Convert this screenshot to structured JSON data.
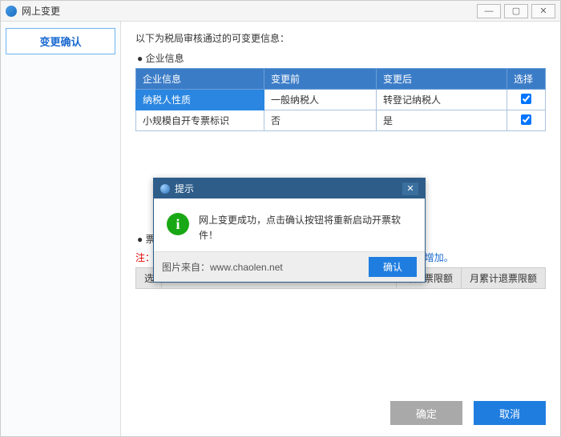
{
  "window": {
    "title": "网上变更"
  },
  "sidebar": {
    "tab_label": "变更确认"
  },
  "main": {
    "intro": "以下为税局审核通过的可变更信息：",
    "section1_title": "企业信息",
    "table": {
      "headers": [
        "企业信息",
        "变更前",
        "变更后",
        "选择"
      ],
      "rows": [
        {
          "c0": "纳税人性质",
          "c1": "一般纳税人",
          "c2": "转登记纳税人",
          "checked": true
        },
        {
          "c0": "小规模自开专票标识",
          "c1": "否",
          "c2": "是",
          "checked": true
        }
      ]
    },
    "section2_title": "票种",
    "note_prefix": "注：",
    "note_tail": "种授权增加。",
    "hdr": {
      "c0": "选",
      "c1": "计开票限额",
      "c2": "月累计退票限额"
    },
    "ok_label": "确定",
    "cancel_label": "取消"
  },
  "dialog": {
    "title": "提示",
    "message": "网上变更成功，点击确认按钮将重新启动开票软件！",
    "watermark": "图片来自：www.chaolen.net",
    "confirm_label": "确认"
  }
}
